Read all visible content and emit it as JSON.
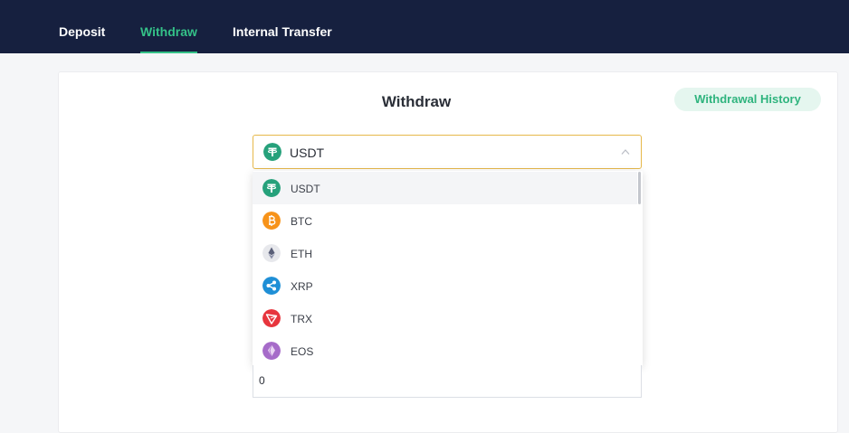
{
  "nav": {
    "tabs": [
      {
        "label": "Deposit",
        "active": false
      },
      {
        "label": "Withdraw",
        "active": true
      },
      {
        "label": "Internal Transfer",
        "active": false
      }
    ]
  },
  "main": {
    "title": "Withdraw",
    "history_button": "Withdrawal History"
  },
  "currency_select": {
    "selected": "USDT",
    "options": [
      {
        "label": "USDT",
        "icon": "usdt-icon",
        "color": "#26a17b"
      },
      {
        "label": "BTC",
        "icon": "btc-icon",
        "color": "#f7931a"
      },
      {
        "label": "ETH",
        "icon": "eth-icon",
        "color": "#62688f"
      },
      {
        "label": "XRP",
        "icon": "xrp-icon",
        "color": "#1f8fd6"
      },
      {
        "label": "TRX",
        "icon": "trx-icon",
        "color": "#e7353d"
      },
      {
        "label": "EOS",
        "icon": "eos-icon",
        "color": "#a66bc9"
      }
    ]
  },
  "amount_field": {
    "value": "0"
  },
  "colors": {
    "accent": "#34c188",
    "nav_bg": "#16203f",
    "select_border": "#e6b84a"
  }
}
